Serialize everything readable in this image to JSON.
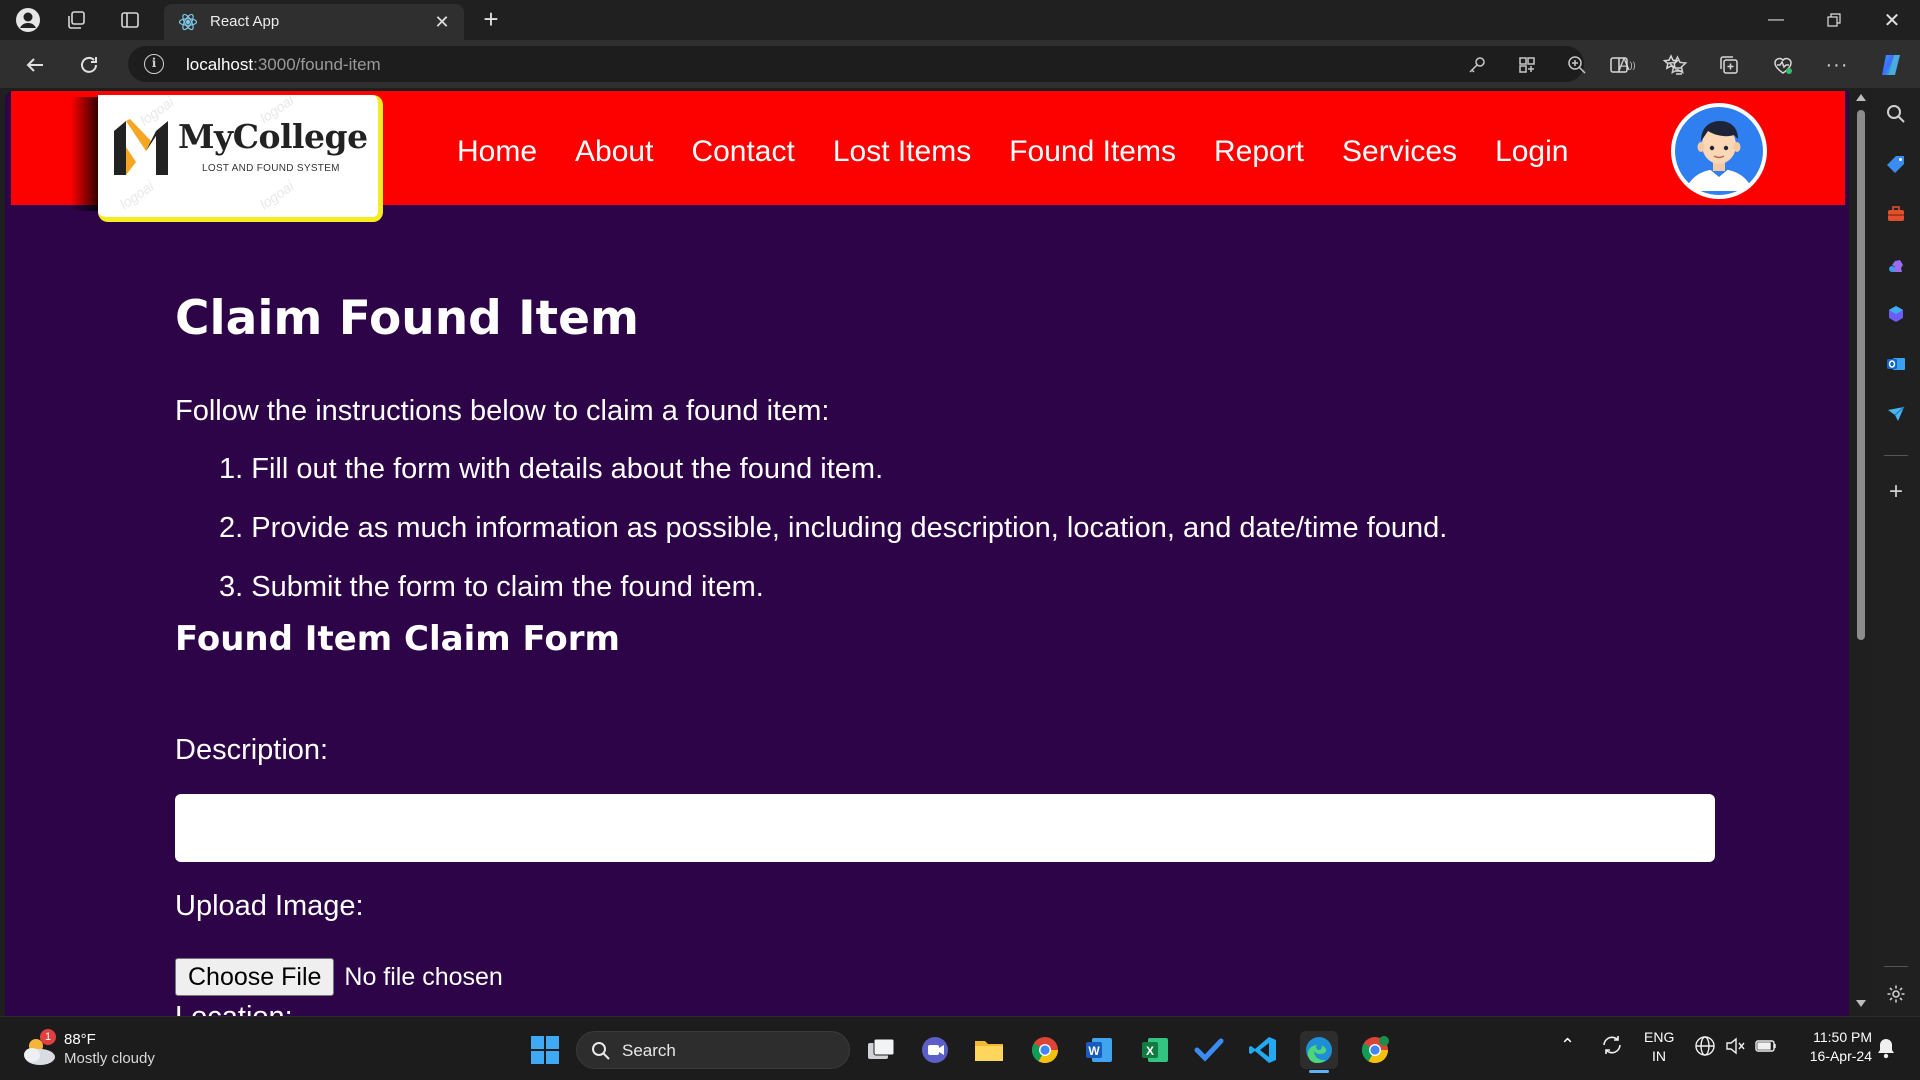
{
  "browser": {
    "tab_title": "React App",
    "url_host": "localhost",
    "url_rest": ":3000/found-item"
  },
  "site": {
    "logo": {
      "name": "MyCollege",
      "subtitle": "LOST AND FOUND SYSTEM",
      "watermark": "logoai"
    },
    "nav": [
      "Home",
      "About",
      "Contact",
      "Lost Items",
      "Found Items",
      "Report",
      "Services",
      "Login"
    ]
  },
  "content": {
    "title": "Claim Found Item",
    "intro": "Follow the instructions below to claim a found item:",
    "steps": [
      "1. Fill out the form with details about the found item.",
      "2. Provide as much information as possible, including description, location, and date/time found.",
      "3. Submit the form to claim the found item."
    ],
    "form_title": "Found Item Claim Form",
    "description_label": "Description:",
    "upload_label": "Upload Image:",
    "file_button": "Choose File",
    "file_status": "No file chosen",
    "location_label": "Location:"
  },
  "taskbar": {
    "weather_badge": "1",
    "weather_temp": "88°F",
    "weather_desc": "Mostly cloudy",
    "search_placeholder": "Search",
    "lang_top": "ENG",
    "lang_bottom": "IN",
    "time": "11:50 PM",
    "date": "16-Apr-24"
  },
  "colors": {
    "header_red": "#fd0000",
    "page_bg": "#2c0447",
    "logo_border": "#f5ec22"
  }
}
